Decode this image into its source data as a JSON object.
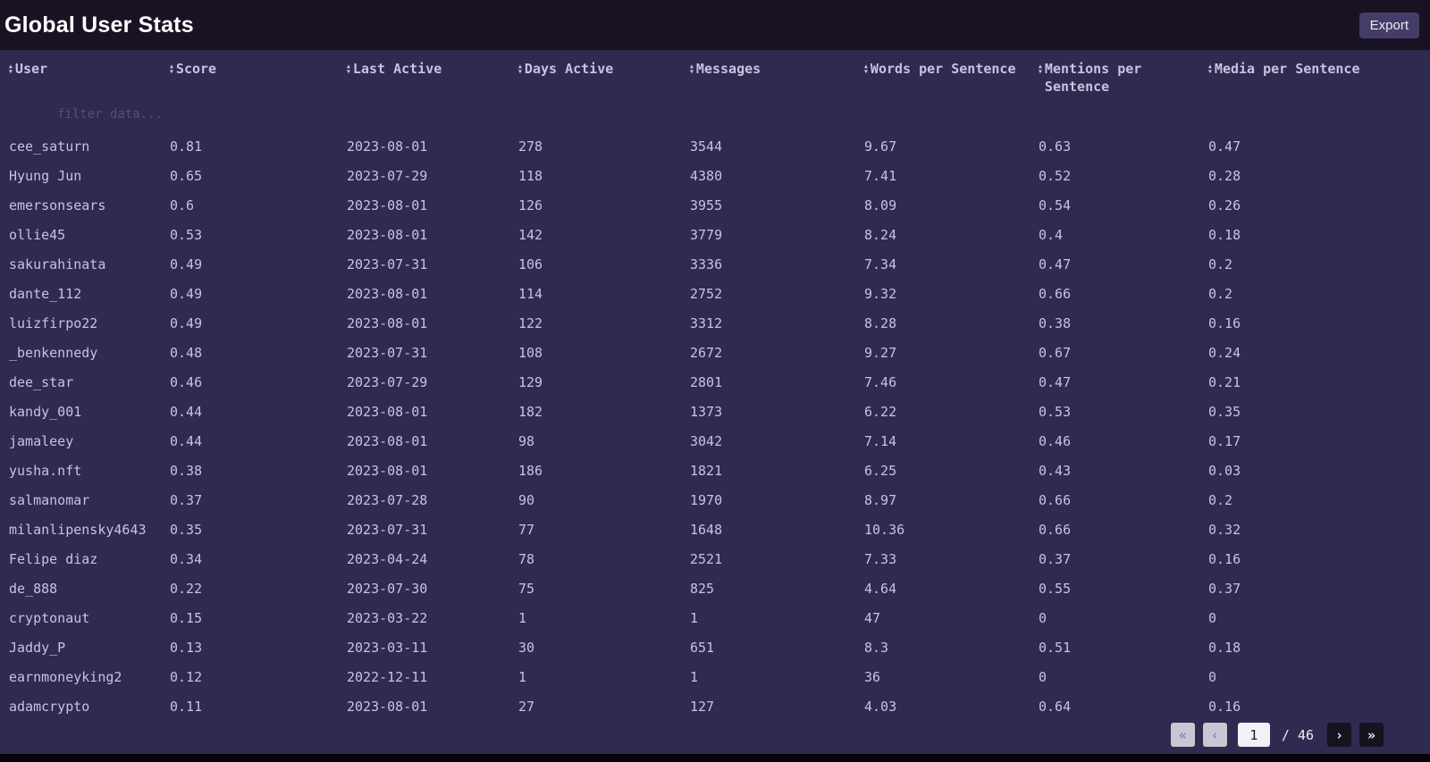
{
  "header": {
    "title": "Global User Stats",
    "export_label": "Export"
  },
  "table": {
    "filter_placeholder": "filter data...",
    "columns": [
      {
        "key": "user",
        "label": "User"
      },
      {
        "key": "score",
        "label": "Score"
      },
      {
        "key": "last-active",
        "label": "Last Active"
      },
      {
        "key": "days-active",
        "label": "Days Active"
      },
      {
        "key": "messages",
        "label": "Messages"
      },
      {
        "key": "words-per-sentence",
        "label": "Words per Sentence"
      },
      {
        "key": "mentions-per-sentence",
        "label": "Mentions per Sentence"
      },
      {
        "key": "media-per-sentence",
        "label": "Media per Sentence"
      }
    ],
    "rows": [
      [
        "cee_saturn",
        "0.81",
        "2023-08-01",
        "278",
        "3544",
        "9.67",
        "0.63",
        "0.47"
      ],
      [
        "Hyung Jun",
        "0.65",
        "2023-07-29",
        "118",
        "4380",
        "7.41",
        "0.52",
        "0.28"
      ],
      [
        "emersonsears",
        "0.6",
        "2023-08-01",
        "126",
        "3955",
        "8.09",
        "0.54",
        "0.26"
      ],
      [
        "ollie45",
        "0.53",
        "2023-08-01",
        "142",
        "3779",
        "8.24",
        "0.4",
        "0.18"
      ],
      [
        "sakurahinata",
        "0.49",
        "2023-07-31",
        "106",
        "3336",
        "7.34",
        "0.47",
        "0.2"
      ],
      [
        "dante_112",
        "0.49",
        "2023-08-01",
        "114",
        "2752",
        "9.32",
        "0.66",
        "0.2"
      ],
      [
        "luizfirpo22",
        "0.49",
        "2023-08-01",
        "122",
        "3312",
        "8.28",
        "0.38",
        "0.16"
      ],
      [
        "_benkennedy",
        "0.48",
        "2023-07-31",
        "108",
        "2672",
        "9.27",
        "0.67",
        "0.24"
      ],
      [
        "dee_star",
        "0.46",
        "2023-07-29",
        "129",
        "2801",
        "7.46",
        "0.47",
        "0.21"
      ],
      [
        "kandy_001",
        "0.44",
        "2023-08-01",
        "182",
        "1373",
        "6.22",
        "0.53",
        "0.35"
      ],
      [
        "jamaleey",
        "0.44",
        "2023-08-01",
        "98",
        "3042",
        "7.14",
        "0.46",
        "0.17"
      ],
      [
        "yusha.nft",
        "0.38",
        "2023-08-01",
        "186",
        "1821",
        "6.25",
        "0.43",
        "0.03"
      ],
      [
        "salmanomar",
        "0.37",
        "2023-07-28",
        "90",
        "1970",
        "8.97",
        "0.66",
        "0.2"
      ],
      [
        "milanlipensky4643",
        "0.35",
        "2023-07-31",
        "77",
        "1648",
        "10.36",
        "0.66",
        "0.32"
      ],
      [
        "Felipe diaz",
        "0.34",
        "2023-04-24",
        "78",
        "2521",
        "7.33",
        "0.37",
        "0.16"
      ],
      [
        "de_888",
        "0.22",
        "2023-07-30",
        "75",
        "825",
        "4.64",
        "0.55",
        "0.37"
      ],
      [
        "cryptonaut",
        "0.15",
        "2023-03-22",
        "1",
        "1",
        "47",
        "0",
        "0"
      ],
      [
        "Jaddy_P",
        "0.13",
        "2023-03-11",
        "30",
        "651",
        "8.3",
        "0.51",
        "0.18"
      ],
      [
        "earnmoneyking2",
        "0.12",
        "2022-12-11",
        "1",
        "1",
        "36",
        "0",
        "0"
      ],
      [
        "adamcrypto",
        "0.11",
        "2023-08-01",
        "27",
        "127",
        "4.03",
        "0.64",
        "0.16"
      ]
    ]
  },
  "pagination": {
    "first_label": "«",
    "prev_label": "‹",
    "current_page": "1",
    "separator": "/",
    "total_pages": "46",
    "next_label": "›",
    "last_label": "»"
  },
  "colors": {
    "background": "#2e2a50",
    "topbar": "#191222",
    "text": "#c7c3e0",
    "export_button": "#433d68",
    "pager_dark": "#16121f"
  }
}
